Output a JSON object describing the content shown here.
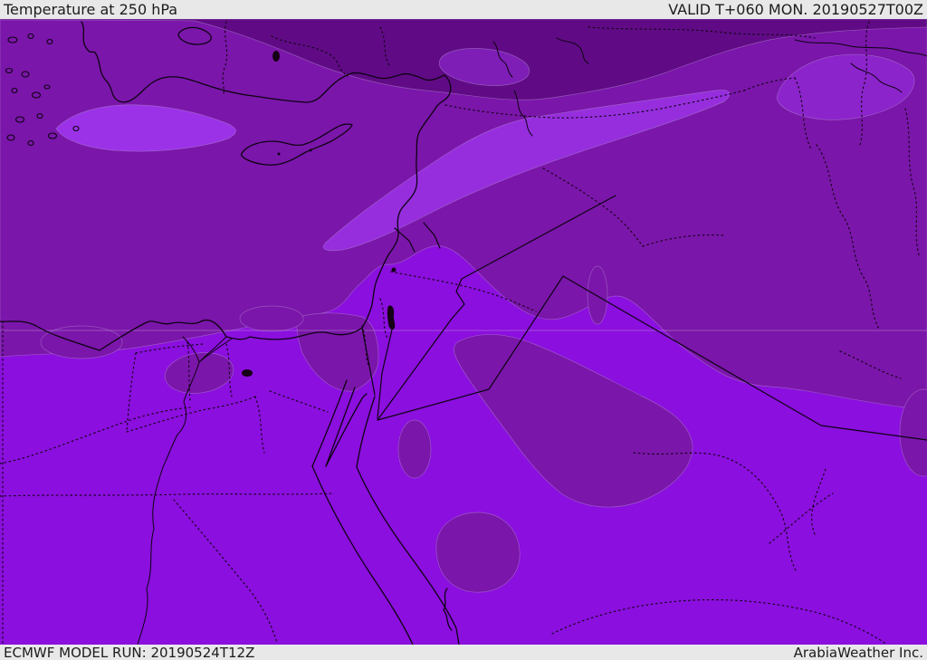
{
  "header": {
    "title": "Temperature at 250 hPa",
    "valid_label": "VALID T+060 MON. 20190527T00Z"
  },
  "footer": {
    "model_run_label": "ECMWF MODEL RUN: 20190524T12Z",
    "credit_label": "ArabiaWeather Inc."
  },
  "map": {
    "colors": {
      "band_coldest": "#600B85",
      "band_cold": "#7B16AA",
      "band_mild": "#8B0FDE",
      "band_warm": "#9B32E8",
      "bar_background": "#e8e8e8",
      "bar_text": "#1c1c1c",
      "coastline": "#0d0212"
    }
  }
}
